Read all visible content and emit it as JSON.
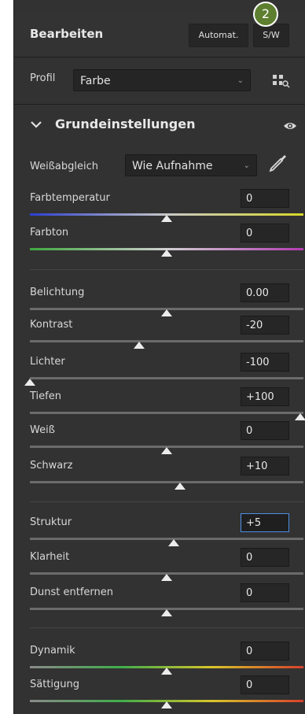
{
  "badge": "2",
  "header": {
    "title": "Bearbeiten",
    "auto_label": "Automat.",
    "bw_label": "S/W"
  },
  "profile": {
    "label": "Profil",
    "value": "Farbe"
  },
  "section": {
    "title": "Grundeinstellungen"
  },
  "wb": {
    "label": "Weißabgleich",
    "value": "Wie Aufnahme"
  },
  "sliders": [
    {
      "label": "Farbtemperatur",
      "value": "0",
      "level": 0.5
    },
    {
      "label": "Farbton",
      "value": "0",
      "level": 0.5
    },
    {
      "label": "Belichtung",
      "value": "0.00",
      "level": 0.5
    },
    {
      "label": "Kontrast",
      "value": "-20",
      "level": 0.4
    },
    {
      "label": "Lichter",
      "value": "-100",
      "level": 0.0
    },
    {
      "label": "Tiefen",
      "value": "+100",
      "level": 1.0
    },
    {
      "label": "Weiß",
      "value": "0",
      "level": 0.5
    },
    {
      "label": "Schwarz",
      "value": "+10",
      "level": 0.55
    },
    {
      "label": "Struktur",
      "value": "+5",
      "level": 0.525
    },
    {
      "label": "Klarheit",
      "value": "0",
      "level": 0.5
    },
    {
      "label": "Dunst entfernen",
      "value": "0",
      "level": 0.5
    },
    {
      "label": "Dynamik",
      "value": "0",
      "level": 0.5
    },
    {
      "label": "Sättigung",
      "value": "0",
      "level": 0.5
    }
  ],
  "colors": {
    "accent": "#4d8ee8",
    "badge": "#5d7f2f",
    "temp_gradient": [
      "#2b3fd0",
      "#c8c8c8",
      "#d8d62a"
    ],
    "tint_gradient": [
      "#3fa83f",
      "#d0d0d0",
      "#b43cb4"
    ],
    "vib_gradient": [
      "#8a8a8a",
      "#3fae4a",
      "#d8c52a",
      "#d8402a"
    ]
  },
  "icons": {
    "grid": "grid-view-icon",
    "eye": "eye-icon",
    "eyedropper": "eyedropper-icon",
    "chevron": "chevron-down-icon"
  }
}
